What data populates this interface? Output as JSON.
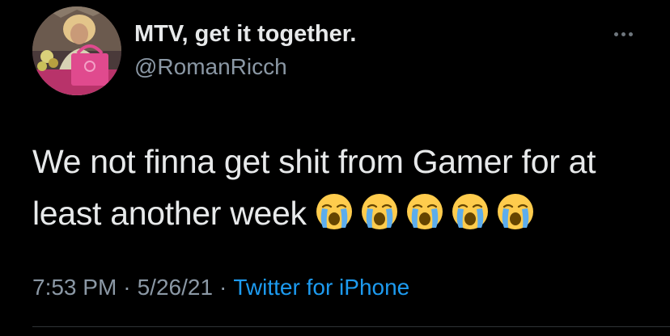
{
  "tweet": {
    "display_name": "MTV, get it together.",
    "handle": "@RomanRicch",
    "text_line1": "We not finna get shit from Gamer for at",
    "text_line2": "least another week",
    "emojis": [
      "loudly-crying-face",
      "loudly-crying-face",
      "loudly-crying-face",
      "loudly-crying-face",
      "loudly-crying-face"
    ],
    "time": "7:53 PM",
    "date": "5/26/21",
    "separator": "·",
    "source": "Twitter for iPhone"
  },
  "colors": {
    "background": "#000000",
    "primary_text": "#e7e9ea",
    "secondary_text": "#8b98a5",
    "link": "#1d9bf0"
  },
  "icons": {
    "more": "more-horizontal-icon"
  }
}
